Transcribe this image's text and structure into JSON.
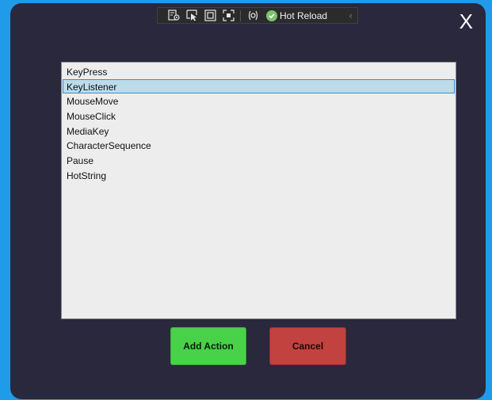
{
  "toolbar": {
    "icons": [
      "live-visual-tree-icon",
      "select-element-icon",
      "display-layout-adorners-icon",
      "track-focus-icon",
      "binding-failures-icon"
    ],
    "hot_reload_label": "Hot Reload",
    "collapse_glyph": "‹"
  },
  "window": {
    "close_label": "X"
  },
  "action_list": {
    "selected_index": 1,
    "items": [
      {
        "label": "KeyPress"
      },
      {
        "label": "KeyListener"
      },
      {
        "label": "MouseMove"
      },
      {
        "label": "MouseClick"
      },
      {
        "label": "MediaKey"
      },
      {
        "label": "CharacterSequence"
      },
      {
        "label": "Pause"
      },
      {
        "label": "HotString"
      }
    ]
  },
  "buttons": {
    "add_label": "Add Action",
    "cancel_label": "Cancel"
  },
  "colors": {
    "background": "#1f9bea",
    "window": "#2a283d",
    "list_background": "#ededed",
    "selection": "#bcdcea",
    "selection_border": "#3b8dd1",
    "add_button": "#4ad14a",
    "cancel_button": "#c1423f"
  }
}
